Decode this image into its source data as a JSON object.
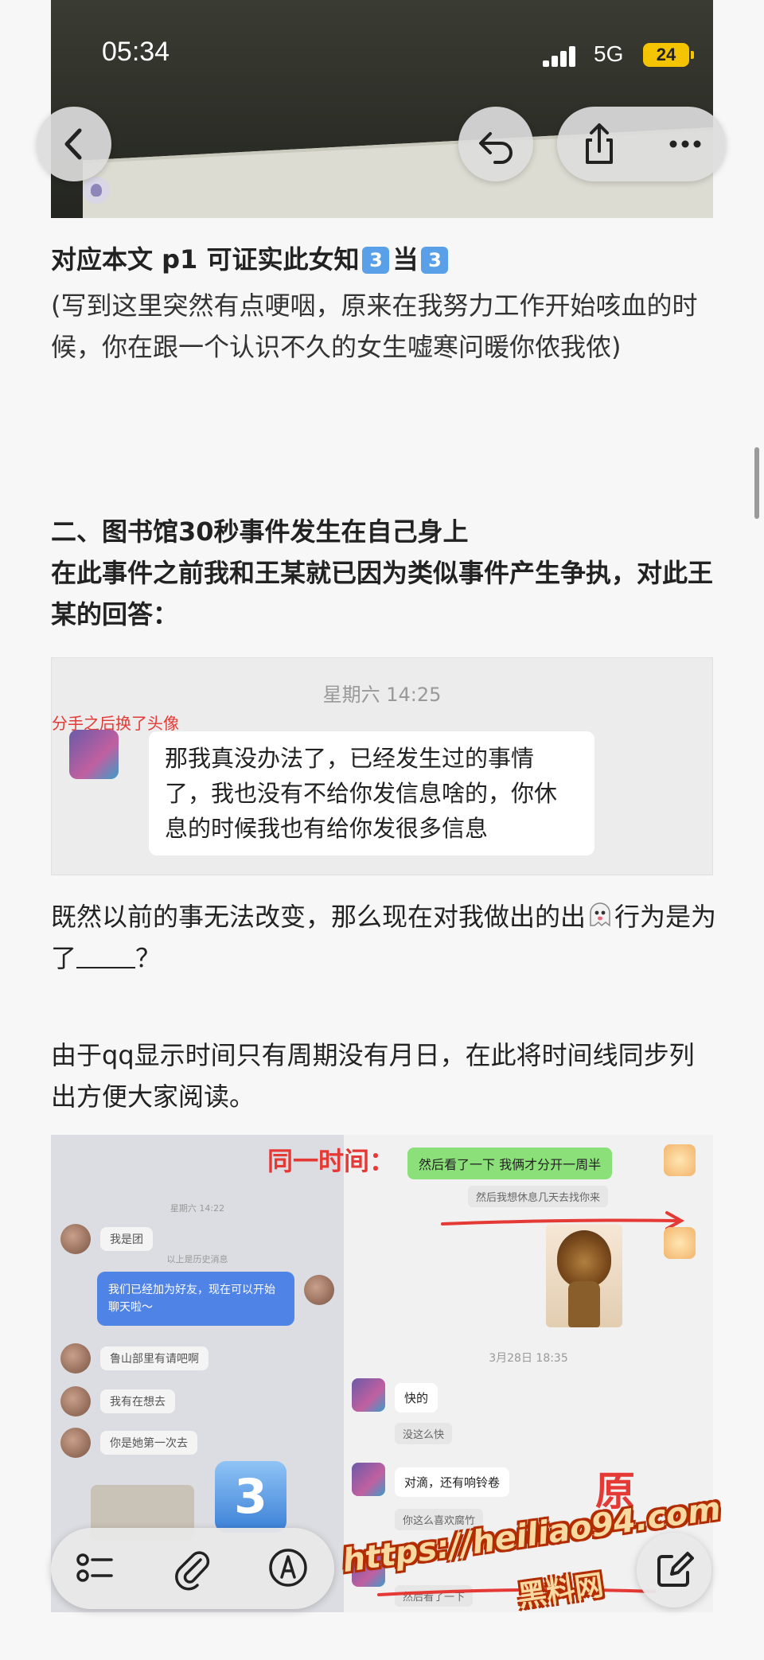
{
  "status_bar": {
    "time": "05:34",
    "network": "5G",
    "battery": "24"
  },
  "paragraphs": {
    "p1_bold_a": "对应本文 p1 可证实此女知",
    "p1_box_a": "3",
    "p1_bold_b": "当",
    "p1_box_b": "3",
    "p1_body": "(写到这里突然有点哽咽，原来在我努力工作开始咳血的时候，你在跟一个认识不久的女生嘘寒问暖你侬我侬)",
    "section2_title": "二、图书馆30秒事件发生在自己身上",
    "section2_body": "在此事件之前我和王某就已因为类似事件产生争执，对此王某的回答：",
    "p3_a": "既然以前的事无法改变，那么现在对我做出的出",
    "p3_b": "行为是为了",
    "p3_c": "？",
    "p4": "由于qq显示时间只有周期没有月日，在此将时间线同步列出方便大家阅读。"
  },
  "chat1": {
    "timestamp": "星期六 14:25",
    "note": "分手之后换了头像",
    "message": "那我真没办法了，已经发生过的事情了，我也没有不给你发信息啥的，你休息的时候我也有给你发很多信息"
  },
  "collage": {
    "left": {
      "meta_top": "星期六 14:22",
      "msg1": "我是团",
      "meta_mid": "以上是历史消息",
      "blue_msg": "我们已经加为好友，现在可以开始聊天啦～",
      "msg2": "鲁山部里有请吧啊",
      "msg3": "我有在想去",
      "msg4": "你是她第一次去",
      "big_number": "3"
    },
    "right": {
      "title": "同一时间：",
      "green_msg": "然后看了一下 我俩才分开一周半",
      "sys1": "然后我想休息几天去找你来",
      "timestamp": "3月28日 18:35",
      "msg_fast": "快的",
      "sys2": "没这么快",
      "msg_drip": "对滴，还有响铃卷",
      "sys3": "你这么喜欢腐竹",
      "big_label": "原",
      "last_line": "然后看了一下"
    }
  },
  "watermark": {
    "url": "https://heiliao94.com",
    "name": "黑料网"
  },
  "icons": {
    "back": "chevron-left-icon",
    "reply": "reply-arrow-icon",
    "share": "share-icon",
    "more": "more-dots-icon",
    "list": "checklist-icon",
    "attach": "paperclip-icon",
    "markup": "markup-pen-icon",
    "compose": "compose-icon"
  },
  "colors": {
    "accent_red": "#e53935",
    "box_blue": "#5aa0e8",
    "battery": "#f5c400"
  }
}
